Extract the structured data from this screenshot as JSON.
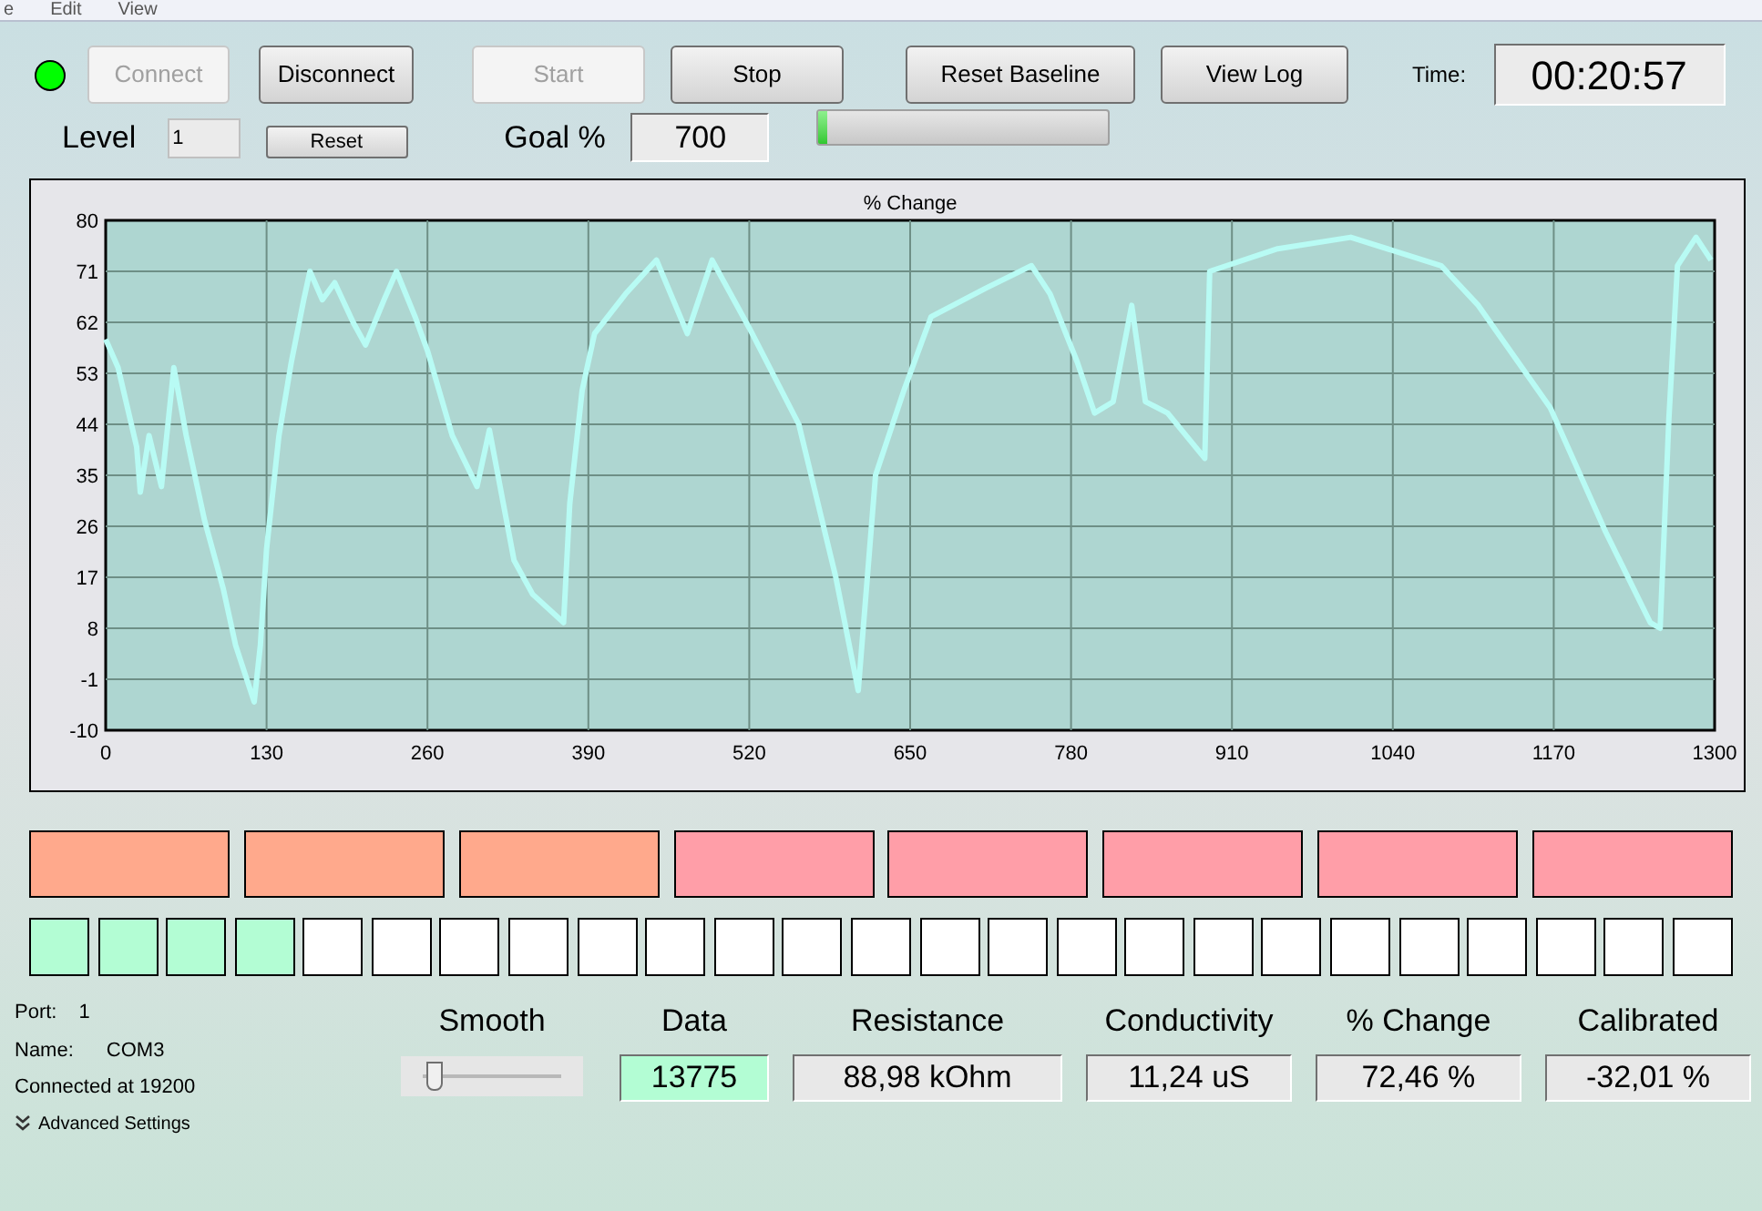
{
  "menu": [
    "e",
    "Edit",
    "View"
  ],
  "toolbar": {
    "connected": true,
    "buttons": [
      {
        "label": "Connect",
        "disabled": true
      },
      {
        "label": "Disconnect",
        "disabled": false
      },
      {
        "label": "Start",
        "disabled": true
      },
      {
        "label": "Stop",
        "disabled": false
      },
      {
        "label": "Reset Baseline",
        "disabled": false
      },
      {
        "label": "View Log",
        "disabled": false
      }
    ],
    "time_label": "Time:",
    "time": "00:20:57"
  },
  "level_row": {
    "level_label": "Level",
    "level_value": "1",
    "reset": "Reset",
    "goal_label": "Goal %",
    "goal_value": "700",
    "goal_progress": {
      "level": 0.03
    }
  },
  "chart": {
    "chart_data": {
      "type": "line",
      "title": "% Change",
      "x": [
        0,
        10,
        25,
        28,
        35,
        45,
        55,
        65,
        80,
        95,
        105,
        120,
        125,
        130,
        140,
        150,
        160,
        165,
        175,
        185,
        200,
        210,
        225,
        235,
        250,
        260,
        280,
        300,
        310,
        330,
        345,
        370,
        375,
        385,
        395,
        420,
        445,
        470,
        490,
        520,
        560,
        590,
        608,
        622,
        645,
        667,
        711,
        748,
        763,
        785,
        799,
        814,
        829,
        840,
        858,
        888,
        892,
        947,
        1006,
        1079,
        1109,
        1167,
        1212,
        1248,
        1256,
        1263,
        1270,
        1285,
        1297
      ],
      "grid": true,
      "series": [
        {
          "color": "#b8fbf4",
          "values": [
            59,
            54,
            40,
            32,
            42,
            33,
            54,
            42,
            27,
            15,
            5,
            -5,
            5,
            22,
            42,
            55,
            66,
            71,
            66,
            69,
            62,
            58,
            66,
            71,
            63,
            57,
            42,
            33,
            43,
            20,
            14,
            9,
            30,
            50,
            60,
            67,
            73,
            60,
            73,
            61,
            44,
            17,
            -3,
            35,
            50,
            63,
            68,
            72,
            67,
            55,
            46,
            48,
            65,
            48,
            46,
            38,
            71,
            75,
            77,
            72,
            65,
            47,
            25,
            9,
            8,
            45,
            72,
            77,
            73
          ]
        }
      ],
      "xlim": [
        0,
        1300
      ],
      "ylim": [
        -10,
        80
      ],
      "xticks": [
        0,
        130,
        260,
        390,
        520,
        650,
        780,
        910,
        1040,
        1170,
        1300
      ],
      "yticks": [
        -10,
        -1,
        8,
        17,
        26,
        35,
        44,
        53,
        62,
        71,
        80
      ]
    }
  },
  "level_blocks": [
    {
      "color": "#ffa98c"
    },
    {
      "color": "#ffa98c"
    },
    {
      "color": "#ffa98c"
    },
    {
      "color": "#ff9ea8"
    },
    {
      "color": "#ff9ea8"
    },
    {
      "color": "#ff9ea8"
    },
    {
      "color": "#ff9ea8"
    },
    {
      "color": "#ff9ea8"
    }
  ],
  "progress_cells": [
    {
      "on": true
    },
    {
      "on": true
    },
    {
      "on": true
    },
    {
      "on": true
    },
    {
      "on": false
    },
    {
      "on": false
    },
    {
      "on": false
    },
    {
      "on": false
    },
    {
      "on": false
    },
    {
      "on": false
    },
    {
      "on": false
    },
    {
      "on": false
    },
    {
      "on": false
    },
    {
      "on": false
    },
    {
      "on": false
    },
    {
      "on": false
    },
    {
      "on": false
    },
    {
      "on": false
    },
    {
      "on": false
    },
    {
      "on": false
    },
    {
      "on": false
    },
    {
      "on": false
    },
    {
      "on": false
    },
    {
      "on": false
    },
    {
      "on": false
    }
  ],
  "port_info": {
    "port_label": "Port:",
    "port": "1",
    "name_label": "Name:",
    "name": "COM3",
    "status": "Connected at 19200",
    "advanced": "Advanced Settings"
  },
  "smooth": {
    "label": "Smooth",
    "level": 0.08
  },
  "readouts": [
    {
      "label": "Data",
      "value": "13775",
      "highlight": true
    },
    {
      "label": "Resistance",
      "value": "88,98 kOhm",
      "highlight": false
    },
    {
      "label": "Conductivity",
      "value": "11,24 uS",
      "highlight": false
    },
    {
      "label": "% Change",
      "value": "72,46 %",
      "highlight": false
    },
    {
      "label": "Calibrated",
      "value": "-32,01 %",
      "highlight": false
    }
  ]
}
